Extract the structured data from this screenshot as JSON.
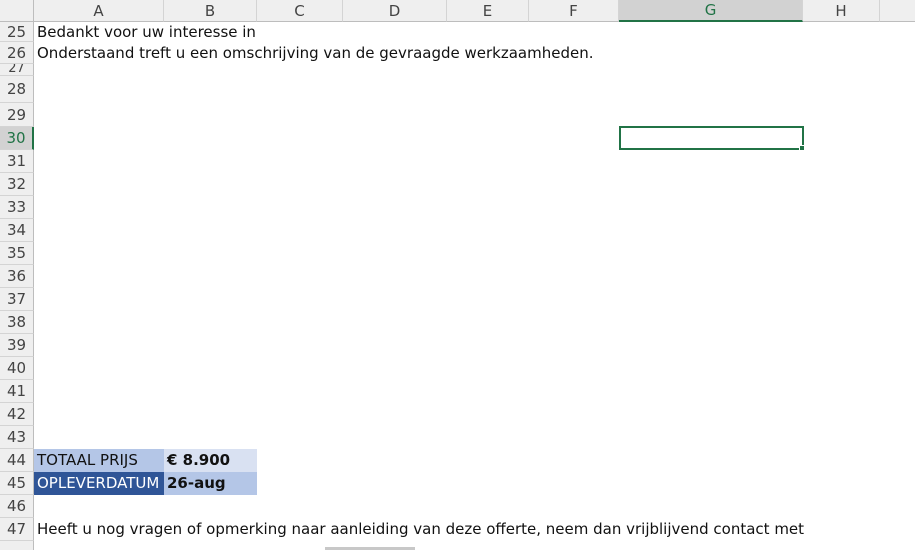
{
  "columns": [
    "A",
    "B",
    "C",
    "D",
    "E",
    "F",
    "G",
    "H"
  ],
  "active_column": "G",
  "rows": [
    "25",
    "26",
    "27",
    "28",
    "29",
    "30",
    "31",
    "32",
    "33",
    "34",
    "35",
    "36",
    "37",
    "38",
    "39",
    "40",
    "41",
    "42",
    "43",
    "44",
    "45",
    "46",
    "47"
  ],
  "active_row": "30",
  "cells": {
    "a25": "Bedankt voor uw interesse in",
    "a26": "Onderstaand treft u een omschrijving van de gevraagde werkzaamheden.",
    "a44": "TOTAAL PRIJS",
    "b44": "€ 8.900",
    "a45": "OPLEVERDATUM",
    "b45": "26-aug",
    "a47": "Heeft u nog vragen of opmerking naar aanleiding van deze offerte, neem dan vrijblijvend contact met"
  },
  "colors": {
    "label_light": "#b4c6e7",
    "label_dark": "#2f5597",
    "value_light": "#d9e1f2",
    "value_mid": "#b4c6e7",
    "selection": "#217346"
  }
}
